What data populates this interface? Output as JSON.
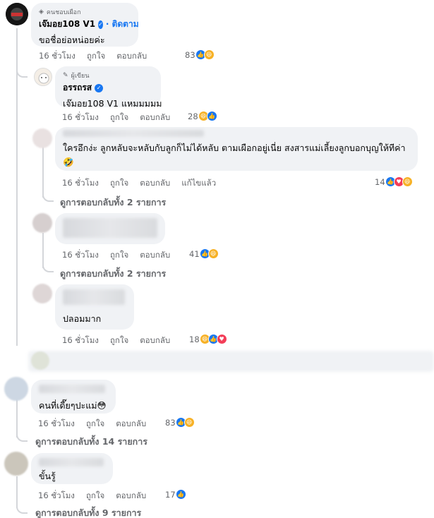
{
  "comments": [
    {
      "badge": "คนชอบเผือก",
      "author": "เจ๊มอย108 V1",
      "follow_label": "· ติดตาม",
      "text": "ขอชื่อย่อหน่อยค่ะ",
      "time": "16 ชั่วโมง",
      "like_label": "ถูกใจ",
      "reply_label": "ตอบกลับ",
      "reaction_count": "83"
    },
    {
      "badge": "ผู้เขียน",
      "author": "อรรถรส",
      "text": "เจ๊มอย108 V1 แหมมมมม",
      "time": "16 ชั่วโมง",
      "like_label": "ถูกใจ",
      "reply_label": "ตอบกลับ",
      "reaction_count": "28"
    },
    {
      "text": "ใครอึกง่ะ ลูกหลับจะหลับกับลูกก็ไม่ได้หลับ ตามเผือกอยู่เนี่ย สงสารแม่เลี้ยงลูกบอกบุญให้ทีค่า🤣",
      "time": "16 ชั่วโมง",
      "like_label": "ถูกใจ",
      "reply_label": "ตอบกลับ",
      "edited_label": "แก้ไขแล้ว",
      "reaction_count": "14",
      "view_replies": "ดูการตอบกลับทั้ง 2 รายการ"
    },
    {
      "time": "16 ชั่วโมง",
      "like_label": "ถูกใจ",
      "reply_label": "ตอบกลับ",
      "reaction_count": "41",
      "view_replies": "ดูการตอบกลับทั้ง 2 รายการ"
    },
    {
      "text": "ปลอมมาก",
      "time": "16 ชั่วโมง",
      "like_label": "ถูกใจ",
      "reply_label": "ตอบกลับ",
      "reaction_count": "18"
    },
    {
      "text": "คนที่เดี๊ยๆปะแม่😳",
      "time": "16 ชั่วโมง",
      "like_label": "ถูกใจ",
      "reply_label": "ตอบกลับ",
      "reaction_count": "83",
      "view_replies": "ดูการตอบกลับทั้ง 14 รายการ"
    },
    {
      "text": "ขั้นรู้",
      "time": "16 ชั่วโมง",
      "like_label": "ถูกใจ",
      "reply_label": "ตอบกลับ",
      "reaction_count": "17",
      "view_replies": "ดูการตอบกลับทั้ง 9 รายการ"
    }
  ],
  "icons": {
    "badge_fan": "diamond-icon",
    "badge_author": "pencil-icon",
    "verified": "verified-check-icon",
    "like": "like-reaction-icon",
    "haha": "haha-reaction-icon",
    "love": "love-reaction-icon"
  },
  "colors": {
    "bubble": "#f0f2f5",
    "meta_text": "#65676b",
    "link_blue": "#1877f2",
    "thread_line": "#d4d6da"
  }
}
